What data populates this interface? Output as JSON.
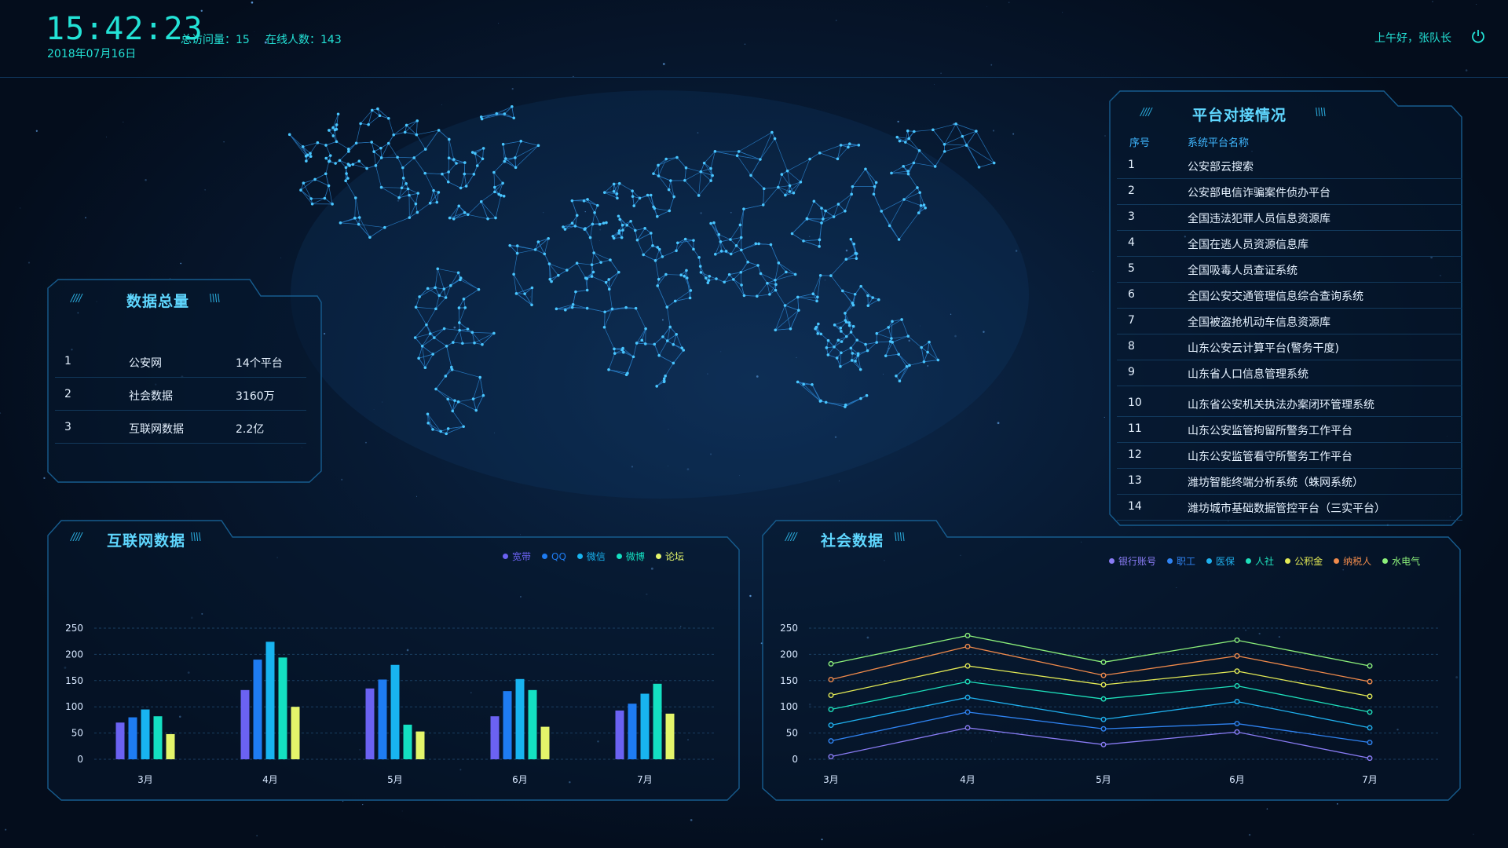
{
  "header": {
    "time": "15:42:23",
    "date": "2018年07月16日",
    "total_visits": "总访问量：15",
    "online_users": "在线人数：143",
    "greeting": "上午好，张队长",
    "power_icon": "power-icon"
  },
  "data_total": {
    "title": "数据总量",
    "rows": [
      {
        "no": "1",
        "name": "公安网",
        "value": "14个平台"
      },
      {
        "no": "2",
        "name": "社会数据",
        "value": "3160万"
      },
      {
        "no": "3",
        "name": "互联网数据",
        "value": "2.2亿"
      }
    ]
  },
  "platforms": {
    "title": "平台对接情况",
    "col_no": "序号",
    "col_name": "系统平台名称",
    "rows": [
      {
        "no": "1",
        "name": "公安部云搜索"
      },
      {
        "no": "2",
        "name": "公安部电信诈骗案件侦办平台"
      },
      {
        "no": "3",
        "name": "全国违法犯罪人员信息资源库"
      },
      {
        "no": "4",
        "name": "全国在逃人员资源信息库"
      },
      {
        "no": "5",
        "name": "全国吸毒人员查证系统"
      },
      {
        "no": "6",
        "name": "全国公安交通管理信息综合查询系统"
      },
      {
        "no": "7",
        "name": "全国被盗抢机动车信息资源库"
      },
      {
        "no": "8",
        "name": "山东公安云计算平台(警务干度)"
      },
      {
        "no": "9",
        "name": "山东省人口信息管理系统"
      },
      {
        "no": "10",
        "name": "山东省公安机关执法办案闭环管理系统"
      },
      {
        "no": "11",
        "name": "山东公安监管拘留所警务工作平台"
      },
      {
        "no": "12",
        "name": "山东公安监管看守所警务工作平台"
      },
      {
        "no": "13",
        "name": "潍坊智能终端分析系统（蛛网系统）"
      },
      {
        "no": "14",
        "name": "潍坊城市基础数据管控平台（三实平台）"
      }
    ]
  },
  "internet": {
    "title": "互联网数据"
  },
  "social": {
    "title": "社会数据"
  },
  "chart_data": [
    {
      "type": "bar",
      "title": "互联网数据",
      "categories": [
        "3月",
        "4月",
        "5月",
        "6月",
        "7月"
      ],
      "yticks": [
        0,
        50,
        100,
        150,
        200,
        250
      ],
      "ylim": [
        0,
        250
      ],
      "grid": true,
      "legend_position": "top-right",
      "series": [
        {
          "name": "宽带",
          "color": "#6b62f2",
          "values": [
            70,
            132,
            135,
            82,
            93
          ]
        },
        {
          "name": "QQ",
          "color": "#1e7cf2",
          "values": [
            80,
            190,
            152,
            130,
            106
          ]
        },
        {
          "name": "微信",
          "color": "#18b4f0",
          "values": [
            95,
            224,
            180,
            153,
            125
          ]
        },
        {
          "name": "微博",
          "color": "#14e0c2",
          "values": [
            82,
            194,
            66,
            132,
            144
          ]
        },
        {
          "name": "论坛",
          "color": "#e4f56a",
          "values": [
            48,
            100,
            53,
            62,
            87
          ]
        }
      ]
    },
    {
      "type": "line",
      "title": "社会数据",
      "categories": [
        "3月",
        "4月",
        "5月",
        "6月",
        "7月"
      ],
      "yticks": [
        0,
        50,
        100,
        150,
        200,
        250
      ],
      "ylim": [
        0,
        250
      ],
      "grid": true,
      "legend_position": "top-right",
      "series": [
        {
          "name": "银行账号",
          "color": "#8a7cf5",
          "values": [
            5,
            60,
            28,
            52,
            2
          ]
        },
        {
          "name": "职工",
          "color": "#2f83f2",
          "values": [
            35,
            90,
            58,
            68,
            32
          ]
        },
        {
          "name": "医保",
          "color": "#1fb0ee",
          "values": [
            65,
            118,
            76,
            110,
            60
          ]
        },
        {
          "name": "人社",
          "color": "#1ee0bb",
          "values": [
            95,
            148,
            115,
            140,
            90
          ]
        },
        {
          "name": "公积金",
          "color": "#e3ea55",
          "values": [
            122,
            178,
            142,
            168,
            120
          ]
        },
        {
          "name": "纳税人",
          "color": "#f08a4b",
          "values": [
            152,
            215,
            160,
            197,
            148
          ]
        },
        {
          "name": "水电气",
          "color": "#8cf07a",
          "values": [
            182,
            236,
            185,
            227,
            178
          ]
        }
      ]
    }
  ]
}
